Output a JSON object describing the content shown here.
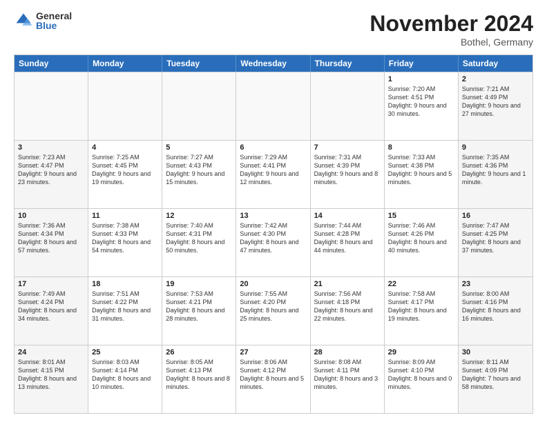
{
  "logo": {
    "general": "General",
    "blue": "Blue"
  },
  "title": "November 2024",
  "location": "Bothel, Germany",
  "header_days": [
    "Sunday",
    "Monday",
    "Tuesday",
    "Wednesday",
    "Thursday",
    "Friday",
    "Saturday"
  ],
  "weeks": [
    [
      {
        "day": "",
        "text": ""
      },
      {
        "day": "",
        "text": ""
      },
      {
        "day": "",
        "text": ""
      },
      {
        "day": "",
        "text": ""
      },
      {
        "day": "",
        "text": ""
      },
      {
        "day": "1",
        "text": "Sunrise: 7:20 AM\nSunset: 4:51 PM\nDaylight: 9 hours and 30 minutes."
      },
      {
        "day": "2",
        "text": "Sunrise: 7:21 AM\nSunset: 4:49 PM\nDaylight: 9 hours and 27 minutes."
      }
    ],
    [
      {
        "day": "3",
        "text": "Sunrise: 7:23 AM\nSunset: 4:47 PM\nDaylight: 9 hours and 23 minutes."
      },
      {
        "day": "4",
        "text": "Sunrise: 7:25 AM\nSunset: 4:45 PM\nDaylight: 9 hours and 19 minutes."
      },
      {
        "day": "5",
        "text": "Sunrise: 7:27 AM\nSunset: 4:43 PM\nDaylight: 9 hours and 15 minutes."
      },
      {
        "day": "6",
        "text": "Sunrise: 7:29 AM\nSunset: 4:41 PM\nDaylight: 9 hours and 12 minutes."
      },
      {
        "day": "7",
        "text": "Sunrise: 7:31 AM\nSunset: 4:39 PM\nDaylight: 9 hours and 8 minutes."
      },
      {
        "day": "8",
        "text": "Sunrise: 7:33 AM\nSunset: 4:38 PM\nDaylight: 9 hours and 5 minutes."
      },
      {
        "day": "9",
        "text": "Sunrise: 7:35 AM\nSunset: 4:36 PM\nDaylight: 9 hours and 1 minute."
      }
    ],
    [
      {
        "day": "10",
        "text": "Sunrise: 7:36 AM\nSunset: 4:34 PM\nDaylight: 8 hours and 57 minutes."
      },
      {
        "day": "11",
        "text": "Sunrise: 7:38 AM\nSunset: 4:33 PM\nDaylight: 8 hours and 54 minutes."
      },
      {
        "day": "12",
        "text": "Sunrise: 7:40 AM\nSunset: 4:31 PM\nDaylight: 8 hours and 50 minutes."
      },
      {
        "day": "13",
        "text": "Sunrise: 7:42 AM\nSunset: 4:30 PM\nDaylight: 8 hours and 47 minutes."
      },
      {
        "day": "14",
        "text": "Sunrise: 7:44 AM\nSunset: 4:28 PM\nDaylight: 8 hours and 44 minutes."
      },
      {
        "day": "15",
        "text": "Sunrise: 7:46 AM\nSunset: 4:26 PM\nDaylight: 8 hours and 40 minutes."
      },
      {
        "day": "16",
        "text": "Sunrise: 7:47 AM\nSunset: 4:25 PM\nDaylight: 8 hours and 37 minutes."
      }
    ],
    [
      {
        "day": "17",
        "text": "Sunrise: 7:49 AM\nSunset: 4:24 PM\nDaylight: 8 hours and 34 minutes."
      },
      {
        "day": "18",
        "text": "Sunrise: 7:51 AM\nSunset: 4:22 PM\nDaylight: 8 hours and 31 minutes."
      },
      {
        "day": "19",
        "text": "Sunrise: 7:53 AM\nSunset: 4:21 PM\nDaylight: 8 hours and 28 minutes."
      },
      {
        "day": "20",
        "text": "Sunrise: 7:55 AM\nSunset: 4:20 PM\nDaylight: 8 hours and 25 minutes."
      },
      {
        "day": "21",
        "text": "Sunrise: 7:56 AM\nSunset: 4:18 PM\nDaylight: 8 hours and 22 minutes."
      },
      {
        "day": "22",
        "text": "Sunrise: 7:58 AM\nSunset: 4:17 PM\nDaylight: 8 hours and 19 minutes."
      },
      {
        "day": "23",
        "text": "Sunrise: 8:00 AM\nSunset: 4:16 PM\nDaylight: 8 hours and 16 minutes."
      }
    ],
    [
      {
        "day": "24",
        "text": "Sunrise: 8:01 AM\nSunset: 4:15 PM\nDaylight: 8 hours and 13 minutes."
      },
      {
        "day": "25",
        "text": "Sunrise: 8:03 AM\nSunset: 4:14 PM\nDaylight: 8 hours and 10 minutes."
      },
      {
        "day": "26",
        "text": "Sunrise: 8:05 AM\nSunset: 4:13 PM\nDaylight: 8 hours and 8 minutes."
      },
      {
        "day": "27",
        "text": "Sunrise: 8:06 AM\nSunset: 4:12 PM\nDaylight: 8 hours and 5 minutes."
      },
      {
        "day": "28",
        "text": "Sunrise: 8:08 AM\nSunset: 4:11 PM\nDaylight: 8 hours and 3 minutes."
      },
      {
        "day": "29",
        "text": "Sunrise: 8:09 AM\nSunset: 4:10 PM\nDaylight: 8 hours and 0 minutes."
      },
      {
        "day": "30",
        "text": "Sunrise: 8:11 AM\nSunset: 4:09 PM\nDaylight: 7 hours and 58 minutes."
      }
    ]
  ]
}
